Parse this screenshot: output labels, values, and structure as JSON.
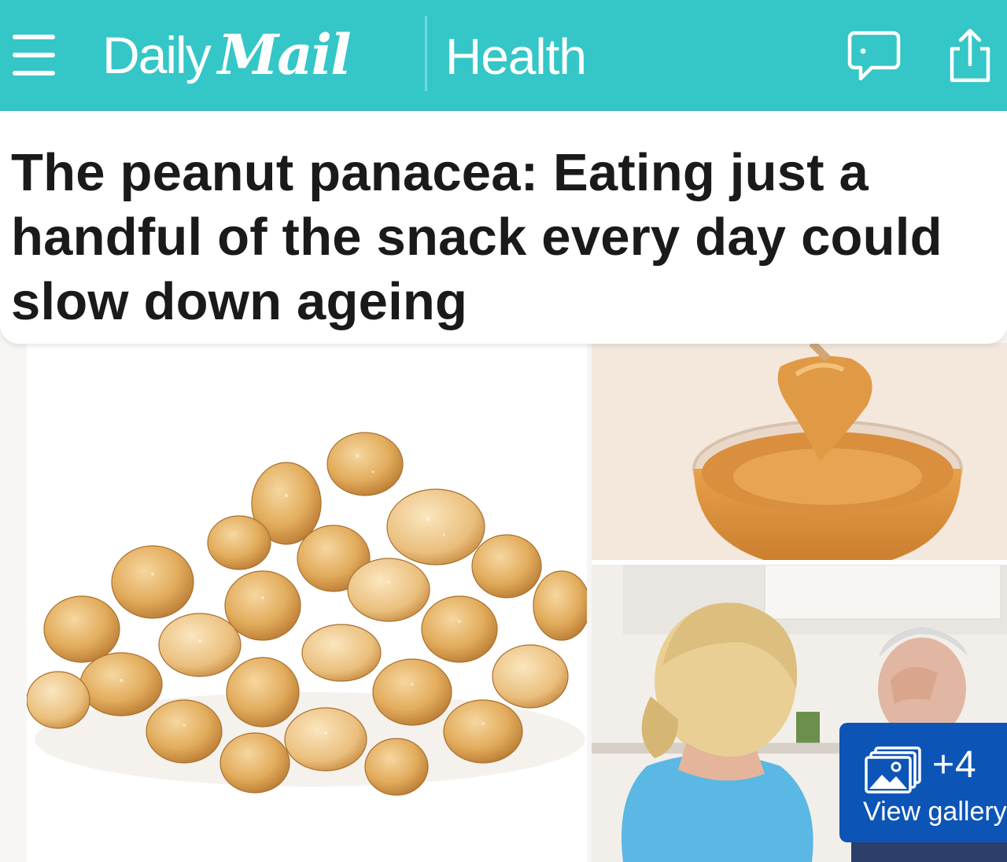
{
  "header": {
    "logo_daily": "Daily",
    "logo_mail": "Mail",
    "section": "Health",
    "bg_color": "#35c6c7",
    "menu_icon": "hamburger-menu-icon",
    "comments_icon": "speech-bubble-icon",
    "share_icon": "share-icon"
  },
  "article": {
    "headline": "The peanut panacea: Eating just a handful of the snack every day could slow down ageing"
  },
  "media": {
    "main_image": "pile of roasted peanuts",
    "top_right_image": "spoon lifting peanut butter from a jar",
    "bottom_right_image": "carer with elderly man holding his head",
    "gallery": {
      "count": "+4",
      "label": "View gallery",
      "icon": "photo-gallery-icon",
      "bg_color": "#0c55b6"
    }
  }
}
